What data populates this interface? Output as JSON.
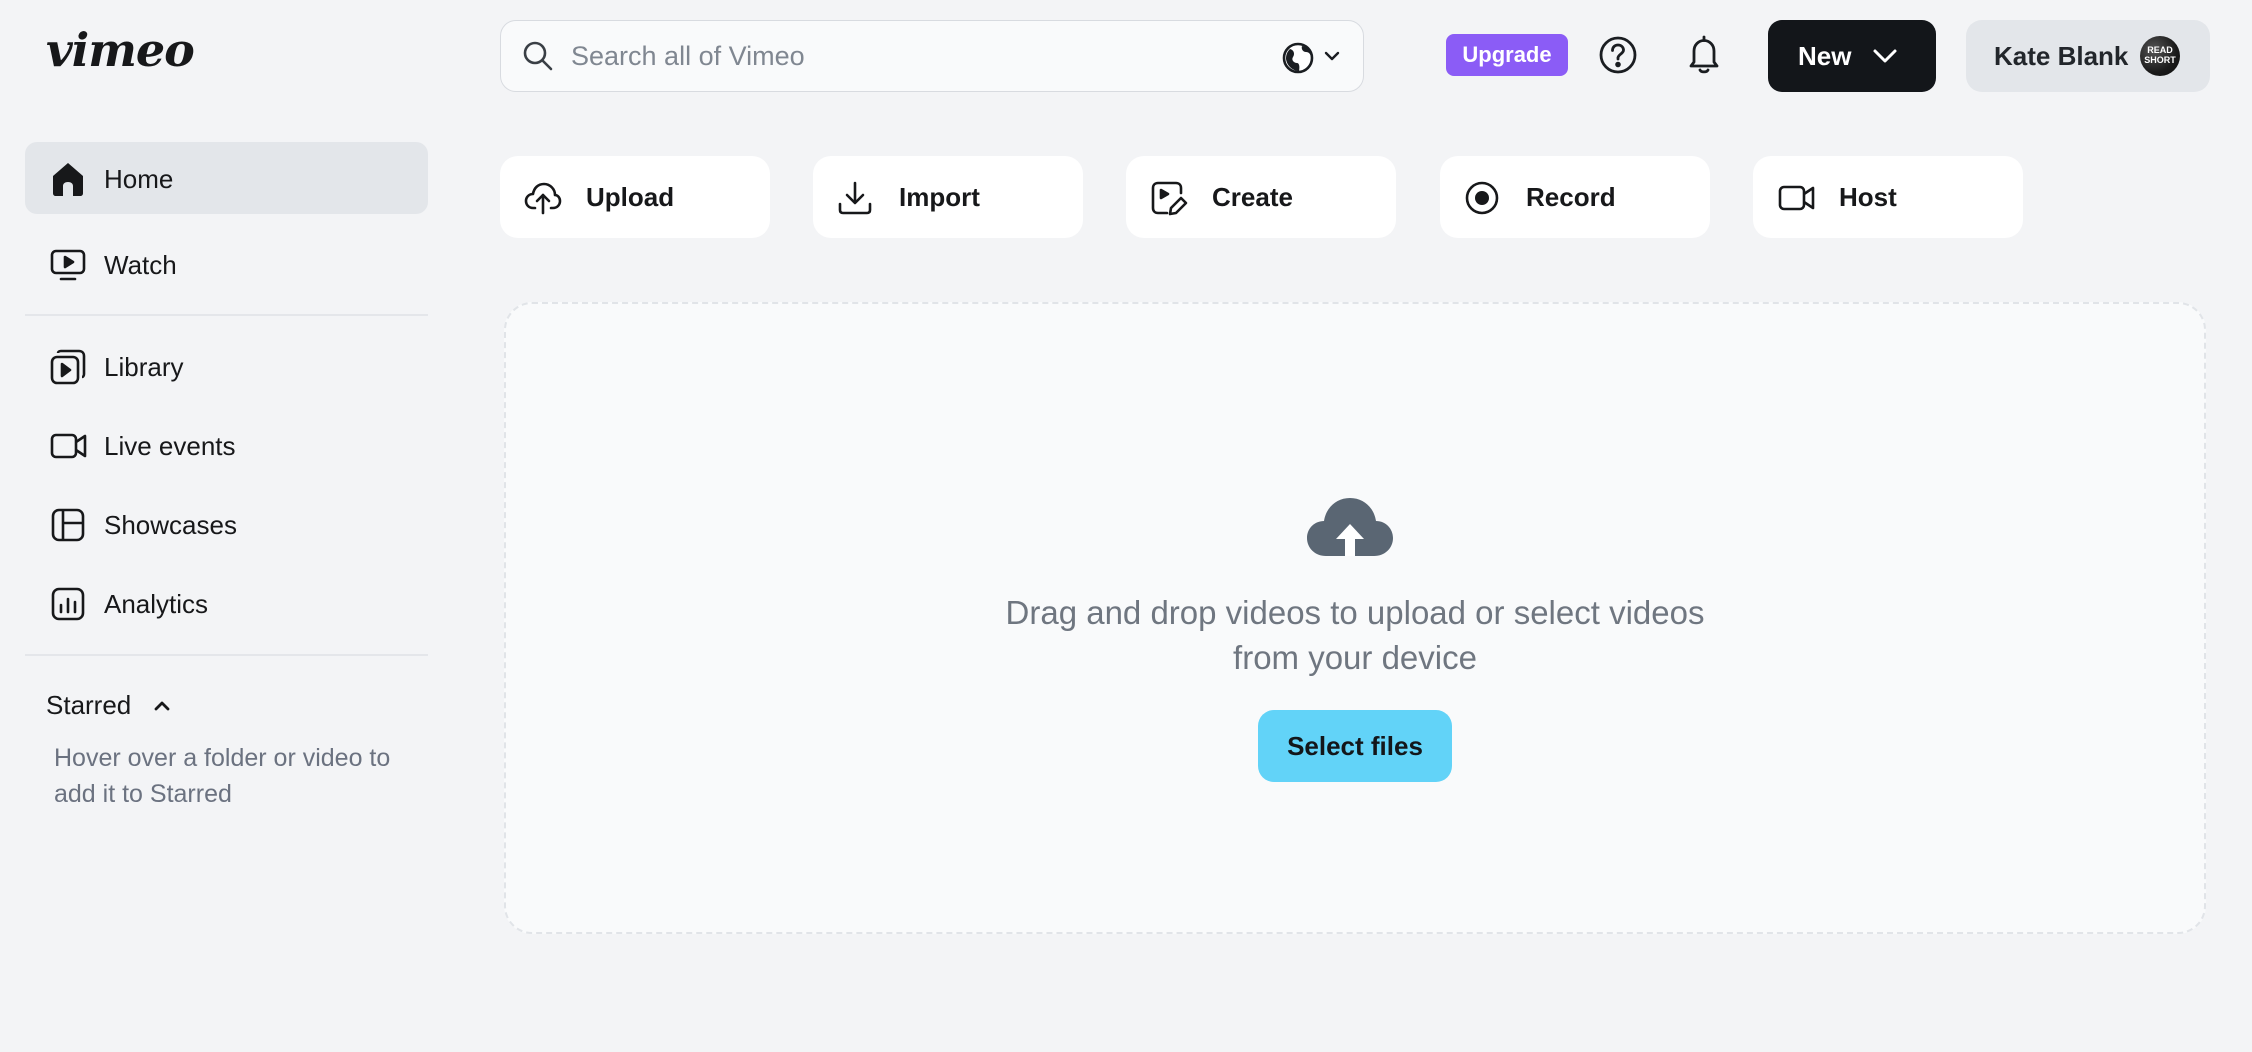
{
  "app": {
    "logo_text": "vimeo"
  },
  "search": {
    "placeholder": "Search all of Vimeo",
    "value": ""
  },
  "header": {
    "upgrade_label": "Upgrade",
    "new_label": "New",
    "user_name": "Kate Blank",
    "avatar_text": "READ SHORT"
  },
  "sidebar": {
    "items": [
      {
        "label": "Home",
        "icon": "home-icon",
        "active": true
      },
      {
        "label": "Watch",
        "icon": "watch-icon"
      },
      {
        "label": "Library",
        "icon": "library-icon"
      },
      {
        "label": "Live events",
        "icon": "video-camera-icon"
      },
      {
        "label": "Showcases",
        "icon": "showcase-icon"
      },
      {
        "label": "Analytics",
        "icon": "analytics-icon"
      }
    ],
    "starred": {
      "title": "Starred",
      "hint": "Hover over a folder or video to add it to Starred"
    }
  },
  "actions": [
    {
      "label": "Upload",
      "icon": "cloud-upload-icon"
    },
    {
      "label": "Import",
      "icon": "download-icon"
    },
    {
      "label": "Create",
      "icon": "create-icon"
    },
    {
      "label": "Record",
      "icon": "record-icon"
    },
    {
      "label": "Host",
      "icon": "video-camera-icon"
    }
  ],
  "dropzone": {
    "text": "Drag and drop videos to upload or select videos from your device",
    "button_label": "Select files"
  },
  "colors": {
    "accent_upgrade": "#8b5cf6",
    "primary_dark": "#13161a",
    "select_button": "#62d3f8",
    "page_bg": "#f3f4f6"
  }
}
